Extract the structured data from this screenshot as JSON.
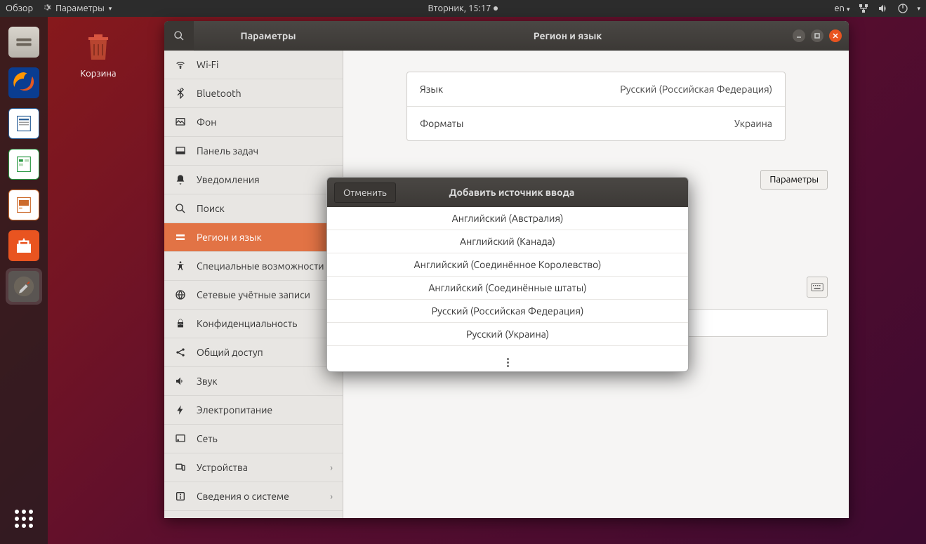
{
  "topbar": {
    "activities": "Обзор",
    "app_menu": "Параметры",
    "datetime": "Вторник, 15:17",
    "lang_indicator": "en"
  },
  "desktop": {
    "trash_label": "Корзина"
  },
  "settings_window": {
    "sidebar_title": "Параметры",
    "content_title": "Регион и язык",
    "params_button": "Параметры"
  },
  "sidebar": {
    "items": [
      {
        "label": "Wi-Fi",
        "icon": "wifi"
      },
      {
        "label": "Bluetooth",
        "icon": "bluetooth"
      },
      {
        "label": "Фон",
        "icon": "background"
      },
      {
        "label": "Панель задач",
        "icon": "dock"
      },
      {
        "label": "Уведомления",
        "icon": "bell"
      },
      {
        "label": "Поиск",
        "icon": "search"
      },
      {
        "label": "Регион и язык",
        "icon": "region",
        "selected": true
      },
      {
        "label": "Специальные возможности",
        "icon": "a11y"
      },
      {
        "label": "Сетевые учётные записи",
        "icon": "accounts"
      },
      {
        "label": "Конфиденциальность",
        "icon": "privacy"
      },
      {
        "label": "Общий доступ",
        "icon": "share"
      },
      {
        "label": "Звук",
        "icon": "sound"
      },
      {
        "label": "Электропитание",
        "icon": "power"
      },
      {
        "label": "Сеть",
        "icon": "network"
      },
      {
        "label": "Устройства",
        "icon": "devices",
        "chevron": true
      },
      {
        "label": "Сведения о системе",
        "icon": "info",
        "chevron": true
      }
    ]
  },
  "region_settings": {
    "language_label": "Язык",
    "language_value": "Русский (Российская Федерация)",
    "formats_label": "Форматы",
    "formats_value": "Украина"
  },
  "dialog": {
    "title": "Добавить источник ввода",
    "cancel": "Отменить",
    "options": [
      "Английский (Австралия)",
      "Английский (Канада)",
      "Английский (Соединённое Королевство)",
      "Английский (Соединённые штаты)",
      "Русский (Российская Федерация)",
      "Русский (Украина)"
    ]
  }
}
